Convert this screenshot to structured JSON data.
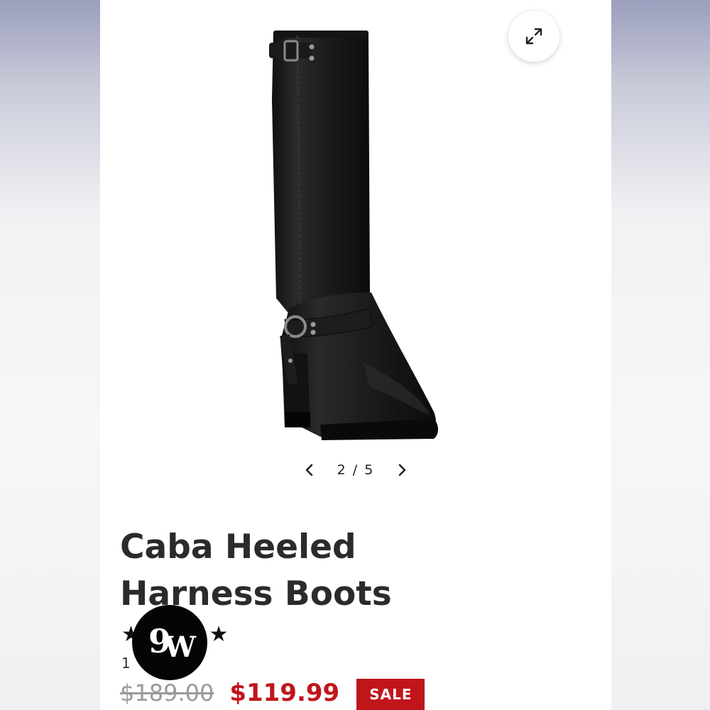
{
  "product": {
    "title": "Caba Heeled Harness Boots",
    "image_alt": "Black leather knee-high heeled harness boot",
    "gallery": {
      "current": "2",
      "separator": "/",
      "total": "5"
    },
    "rating": {
      "stars": 5,
      "review_count": "1"
    },
    "price": {
      "original": "$189.00",
      "sale": "$119.99",
      "badge": "SALE"
    }
  },
  "watermark": {
    "text": "9W"
  },
  "icons": {
    "expand": "expand-arrows-icon",
    "prev": "chevron-left-icon",
    "next": "chevron-right-icon",
    "star": "star-icon"
  },
  "colors": {
    "sale_red": "#c0151b",
    "title_text": "#2b2b2b",
    "old_price": "#9a9a9a"
  }
}
